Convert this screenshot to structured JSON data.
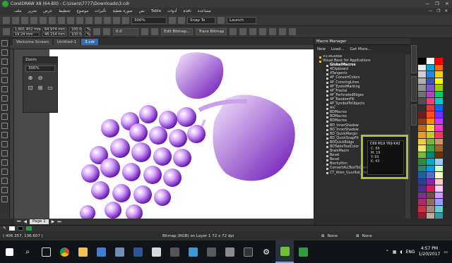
{
  "window": {
    "title": "CorelDRAW X8 (64-Bit) - C:\\Users\\7777\\Downloads\\3.cdr",
    "controls": [
      "—",
      "❐",
      "✕"
    ]
  },
  "menubar": {
    "items": [
      "ملف",
      "تحرير",
      "عرض",
      "تخطيط",
      "موضوع",
      "تأثيرات",
      "صورة نقطية",
      "نص",
      "Table",
      "أدوات",
      "نافذة",
      "مساعدة"
    ],
    "controls": [
      "—",
      "❐",
      "✕"
    ]
  },
  "toolbar": {
    "zoom_value": "300%",
    "snap_to": "Snap To",
    "launch": "Launch"
  },
  "propbar": {
    "x": "1,601.452 mm",
    "y": "19.24 mm",
    "w": "64.974 mm",
    "h": "48.154 mm",
    "scale_w": "100.0",
    "scale_h": "100.0",
    "pct": "%",
    "angle": "0.0",
    "edit_bitmap": "Edit Bitmap...",
    "trace_bitmap": "Trace Bitmap"
  },
  "tabs": [
    {
      "label": "Welcome Screen"
    },
    {
      "label": "Untitled-1"
    },
    {
      "label": "3.cdr"
    }
  ],
  "zoom_dock": {
    "title": "Zoom",
    "value": "300%"
  },
  "page_nav": {
    "page_label": "Page 1"
  },
  "macro_manager": {
    "title": "Macro Manager",
    "new_label": "New",
    "load_label": "Load...",
    "get_more_label": "Get More...",
    "items": [
      {
        "label": "VSTAGlobal",
        "level": 0
      },
      {
        "label": "Visual Basic for Applications",
        "level": 0
      },
      {
        "label": "GlobalMacros",
        "level": 1,
        "bold": true
      },
      {
        "label": "4Clipboard",
        "level": 1
      },
      {
        "label": "4Tangents",
        "level": 1
      },
      {
        "label": "4P_ConvertColors",
        "level": 1
      },
      {
        "label": "4P_CrossingLines",
        "level": 1
      },
      {
        "label": "4P_EyeletMarking",
        "level": 1
      },
      {
        "label": "4P_Fractal",
        "level": 1
      },
      {
        "label": "4P_PerforatedEdges",
        "level": 1
      },
      {
        "label": "4P_RandomFill",
        "level": 1
      },
      {
        "label": "4P_SymbolToObjects",
        "level": 1
      },
      {
        "label": "Arc",
        "level": 1
      },
      {
        "label": "BDMacros",
        "level": 1
      },
      {
        "label": "BDMacros",
        "level": 1
      },
      {
        "label": "BDMacros",
        "level": 1
      },
      {
        "label": "BD_InnerShadow",
        "level": 1
      },
      {
        "label": "BD_InnerShadow",
        "level": 1
      },
      {
        "label": "BD_QuickMargin",
        "level": 1
      },
      {
        "label": "BD_QuickSnapFit",
        "level": 1
      },
      {
        "label": "BDQuickRidge",
        "level": 1
      },
      {
        "label": "BDTableToolColor",
        "level": 1
      },
      {
        "label": "BrainMacro",
        "level": 1
      },
      {
        "label": "Bevel",
        "level": 1
      },
      {
        "label": "Bevel",
        "level": 1
      },
      {
        "label": "Biorhythm",
        "level": 1
      },
      {
        "label": "ConvertALLTextToCurves",
        "level": 1
      },
      {
        "label": "CT_Alien_Uuurlluk_Hexaplays",
        "level": 1
      }
    ]
  },
  "color_tip": {
    "title": "C69 M19 Y69 K43",
    "lines": [
      "C: 69",
      "M: 19",
      "Y: 69",
      "K: 43"
    ]
  },
  "palette": {
    "col1": [
      "#000000",
      "#e8e8e8",
      "#d0d0d0",
      "#b0b0b0",
      "#909090",
      "#707070",
      "#505050",
      "#303030",
      "#6a1f1f",
      "#8b3a1a",
      "#c26a1a",
      "#e89a28",
      "#f2c84a",
      "#efe37a",
      "#7ab63b",
      "#2e8a3e",
      "#2a7f7a",
      "#1f5f9e",
      "#2a3f8f",
      "#4a2f8f",
      "#7a2f8f",
      "#a22f6a",
      "#c8334a",
      "#8f1f2f"
    ],
    "col2": [
      "#ffffff",
      "#00a6d6",
      "#1e88e5",
      "#3f51b5",
      "#7e57c2",
      "#ab47bc",
      "#ec407a",
      "#e53935",
      "#f4511e",
      "#fb8c00",
      "#fdd835",
      "#c0ca33",
      "#7cb342",
      "#43a047",
      "#00897b",
      "#00acc1",
      "#039be5",
      "#5c6bc0",
      "#8e24aa",
      "#d81b60",
      "#6d4c41",
      "#8d6e63",
      "#a1887f",
      "#bcaaa4"
    ],
    "col3": [
      "#ff0000",
      "#ff6600",
      "#ffcc00",
      "#ffff00",
      "#99cc00",
      "#00cc66",
      "#00cccc",
      "#0066ff",
      "#6633ff",
      "#cc33ff",
      "#ff33cc",
      "#ff3366",
      "#cc9966",
      "#996633",
      "#663300",
      "#99ccff",
      "#ccffcc",
      "#ffffcc",
      "#ffcccc",
      "#ffccff",
      "#cc99ff",
      "#9999ff",
      "#66cccc",
      "#339999"
    ]
  },
  "status": {
    "cursor_pos": "( 406.357, 136.607 )",
    "object_info": "Bitmap (RGB) on Layer 1 72 x 72 dpi",
    "fill_none": "None",
    "outline_none": "None"
  },
  "taskbar": {
    "time": "4:57 PM",
    "date": "1/20/2017",
    "language": "ENG"
  }
}
